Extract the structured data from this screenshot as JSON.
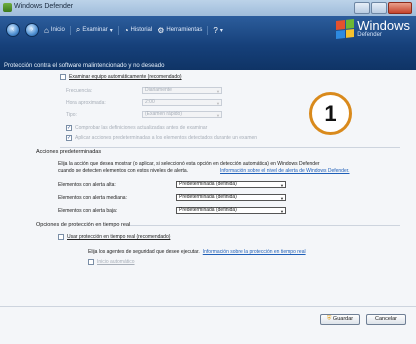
{
  "window": {
    "title": "Windows Defender"
  },
  "toolbar": {
    "items": [
      {
        "icon": "home-icon",
        "label": "Inicio"
      },
      {
        "icon": "scan-icon",
        "label": "Examinar"
      },
      {
        "icon": "history-icon",
        "label": "Historial"
      },
      {
        "icon": "tools-icon",
        "label": "Herramientas"
      }
    ]
  },
  "brand": {
    "name": "Windows",
    "product": "Defender"
  },
  "subtitle": "Protección contra el software malintencionado y no deseado",
  "auto_scan": {
    "label": "Examinar equipo automáticamente (recomendado)",
    "frequency_label": "Frecuencia:",
    "frequency_value": "Diariamente",
    "time_label": "Hora aproximada:",
    "time_value": "2:00",
    "type_label": "Tipo:",
    "type_value": "(Examen rápido)",
    "check_defs_label": "Comprobar las definiciones actualizadas antes de examinar",
    "apply_defaults_label": "Aplicar acciones predeterminadas a los elementos detectados durante un examen"
  },
  "default_actions": {
    "heading": "Acciones predeterminadas",
    "description_1": "Elija la acción que desea mostrar (o aplicar, si seleccionó esta opción en detección automática) en Windows Defender",
    "description_2": "cuando se detecten elementos con estos niveles de alerta.",
    "link": "Información sobre el nivel de alerta de Windows Defender.",
    "rows": [
      {
        "label": "Elementos con alerta alta:",
        "value": "Predeterminada (definida)"
      },
      {
        "label": "Elementos con alerta mediana:",
        "value": "Predeterminada (definida)"
      },
      {
        "label": "Elementos con alerta baja:",
        "value": "Predeterminada (definida)"
      }
    ]
  },
  "realtime": {
    "heading": "Opciones de protección en tiempo real",
    "enable_label": "Usar protección en tiempo real (recomendado)",
    "agents_text": "Elija los agentes de seguridad que desee ejecutar.",
    "agents_link": "Información sobre la protección en tiempo real",
    "startup_label": "Inicio automático"
  },
  "badge": "1",
  "buttons": {
    "save": "Guardar",
    "cancel": "Cancelar"
  }
}
